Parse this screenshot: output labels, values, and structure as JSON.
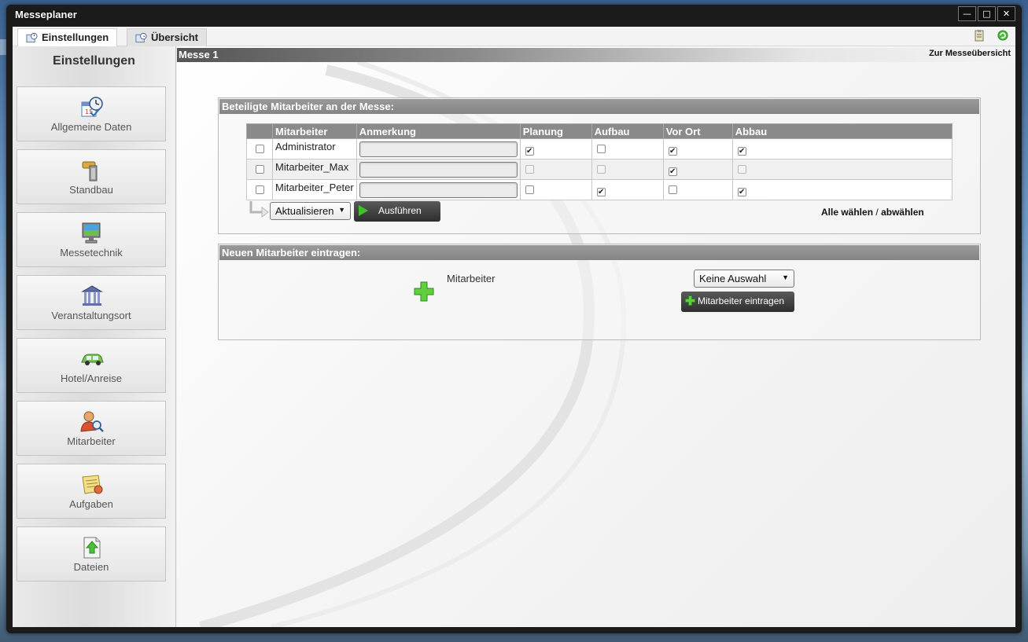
{
  "window": {
    "title": "Messeplaner",
    "buttons": [
      "minimize",
      "maximize",
      "close"
    ]
  },
  "tabs": [
    {
      "label": "Einstellungen",
      "icon": "settings-tab-icon",
      "active": true
    },
    {
      "label": "Übersicht",
      "icon": "overview-tab-icon",
      "active": false
    }
  ],
  "sidebar": {
    "title": "Einstellungen",
    "items": [
      {
        "label": "Allgemeine Daten",
        "icon": "calendar-clock-icon"
      },
      {
        "label": "Standbau",
        "icon": "hammer-icon"
      },
      {
        "label": "Messetechnik",
        "icon": "monitor-icon"
      },
      {
        "label": "Veranstaltungsort",
        "icon": "building-icon"
      },
      {
        "label": "Hotel/Anreise",
        "icon": "car-icon"
      },
      {
        "label": "Mitarbeiter",
        "icon": "user-search-icon"
      },
      {
        "label": "Aufgaben",
        "icon": "tasks-icon"
      },
      {
        "label": "Dateien",
        "icon": "file-upload-icon"
      }
    ]
  },
  "main": {
    "header": "Messe 1",
    "overview_link": "Zur Messeübersicht",
    "participants": {
      "title": "Beteiligte Mitarbeiter an der Messe:",
      "columns": [
        "",
        "Mitarbeiter",
        "Anmerkung",
        "Planung",
        "Aufbau",
        "Vor Ort",
        "Abbau"
      ],
      "rows": [
        {
          "name": "Administrator",
          "note": "",
          "planung": true,
          "aufbau": false,
          "vor_ort": true,
          "abbau": true
        },
        {
          "name": "Mitarbeiter_Max",
          "note": "",
          "planung": false,
          "aufbau": false,
          "vor_ort": true,
          "abbau": false
        },
        {
          "name": "Mitarbeiter_Peter",
          "note": "",
          "planung": false,
          "aufbau": true,
          "vor_ort": false,
          "abbau": true
        }
      ],
      "bulk_action": "Aktualisieren",
      "execute_label": "Ausführen",
      "select_all": "Alle wählen",
      "separator": "/",
      "deselect_all": "abwählen"
    },
    "new_employee": {
      "title": "Neuen Mitarbeiter eintragen:",
      "field_label": "Mitarbeiter",
      "select_value": "Keine Auswahl",
      "add_label": "Mitarbeiter eintragen"
    }
  },
  "colors": {
    "accent_green": "#3fbf2a",
    "header_gray": "#8a8a8a",
    "button_dark": "#2e2e2e"
  }
}
